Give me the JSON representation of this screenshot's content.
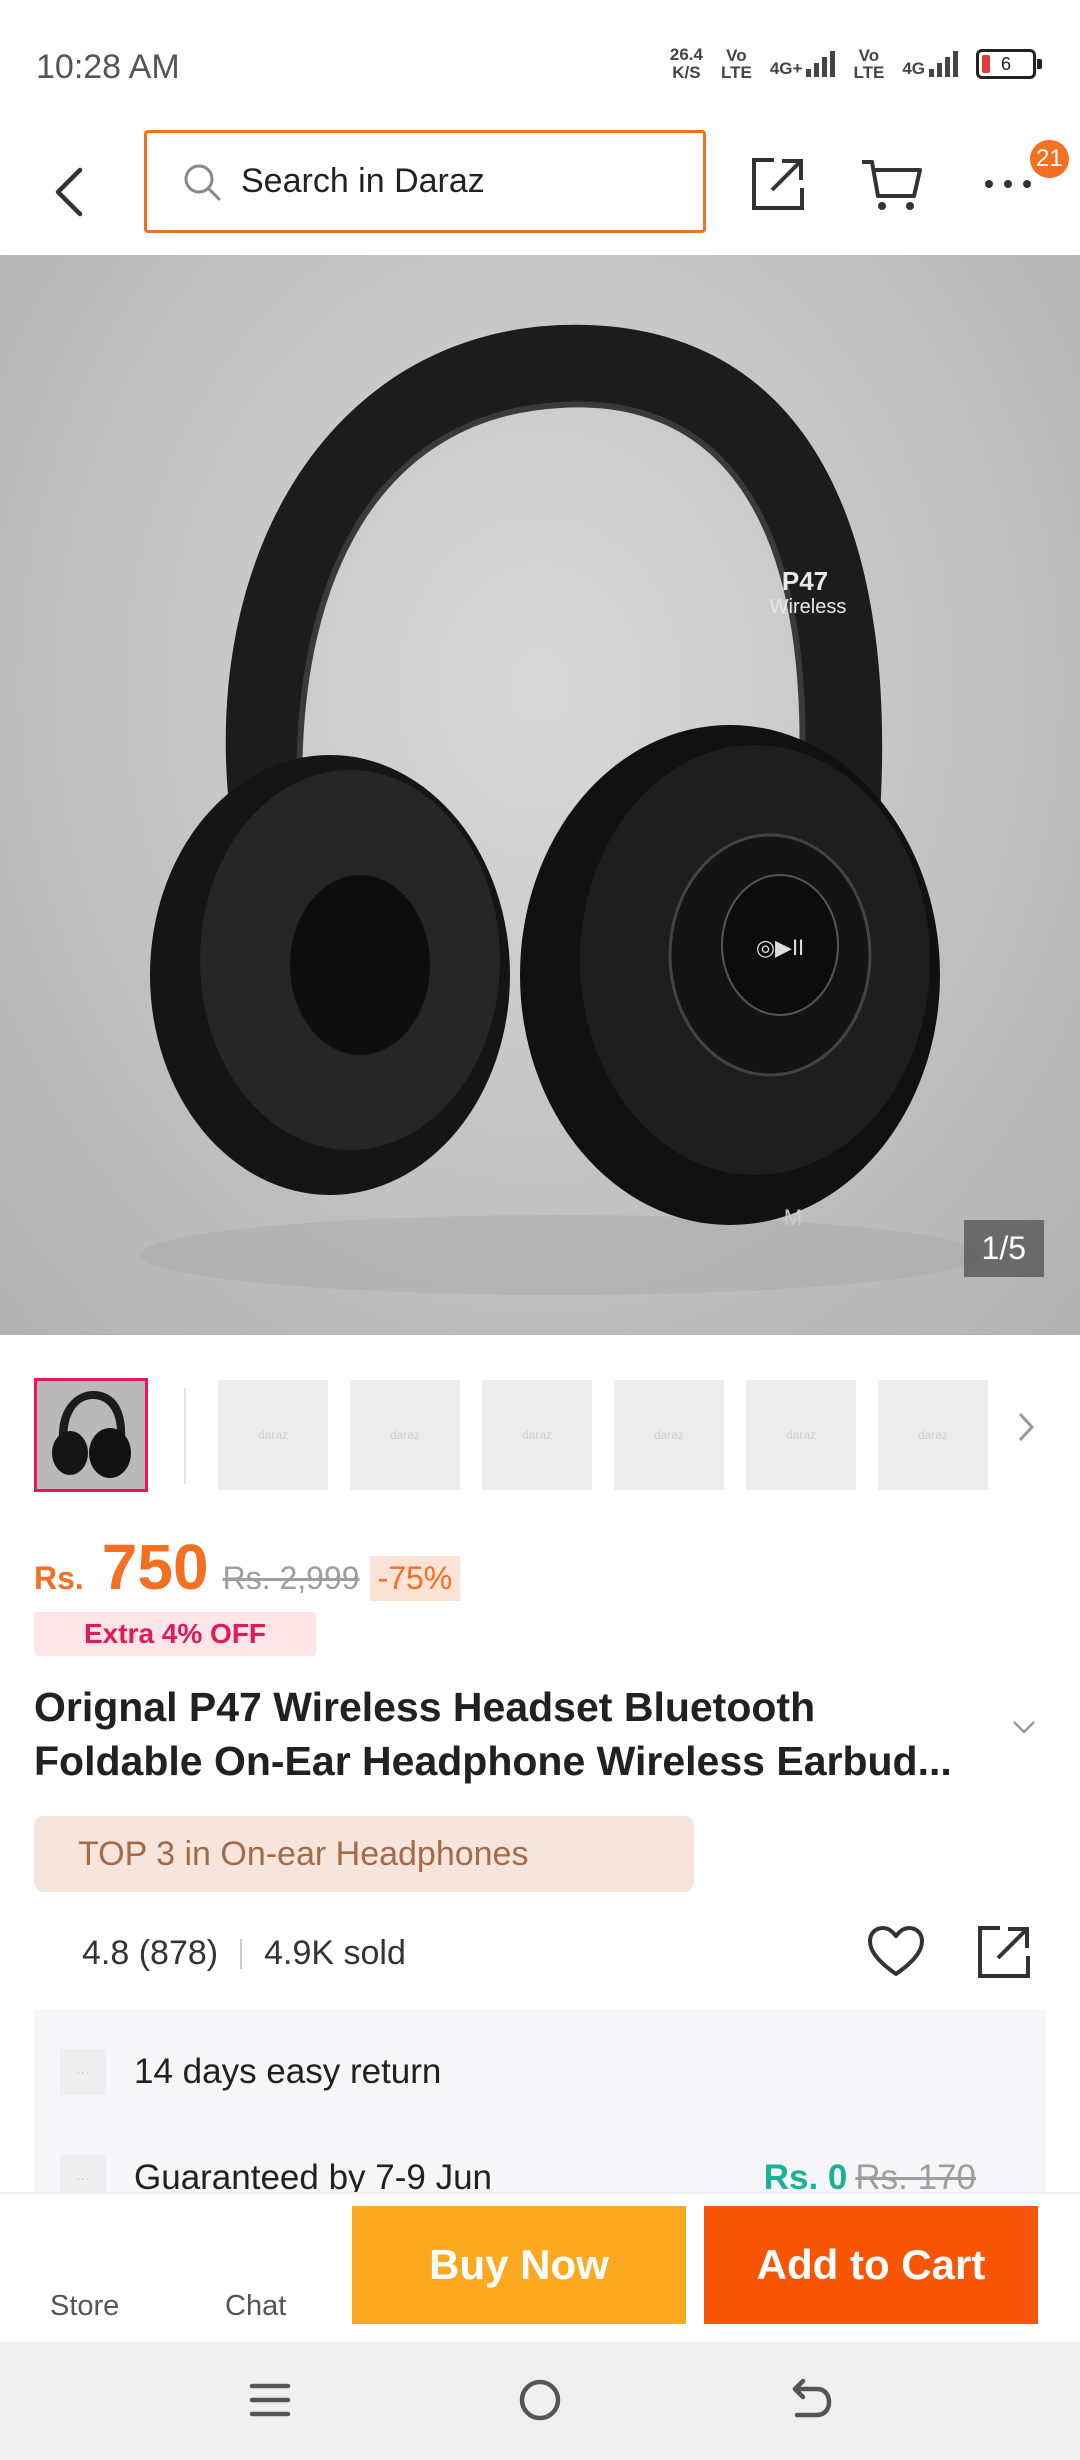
{
  "status_bar": {
    "time": "10:28 AM",
    "net_speed_value": "26.4",
    "net_speed_unit": "K/S",
    "sim1_label_top": "Vo",
    "sim1_label_bottom": "LTE",
    "sim1_net": "4G+",
    "sim2_label_top": "Vo",
    "sim2_label_bottom": "LTE",
    "sim2_net": "4G",
    "battery_level": "6"
  },
  "header": {
    "search_placeholder": "Search in Daraz",
    "more_badge": "21",
    "icons": [
      "back-arrow-icon",
      "search-icon",
      "share-icon",
      "cart-icon",
      "more-icon"
    ]
  },
  "gallery": {
    "counter": "1/5",
    "product_text_line1": "P47",
    "product_text_line2": "Wireless",
    "button_label": "M",
    "thumbnail_placeholder": "daraz"
  },
  "product": {
    "currency": "Rs.",
    "price": "750",
    "old_price": "Rs. 2,999",
    "discount": "-75%",
    "extra_offer": "Extra 4% OFF",
    "title": "Orignal P47 Wireless Headset Bluetooth Foldable On-Ear Headphone Wireless Earbud...",
    "top_tag": "TOP 3 in On-ear Headphones",
    "rating": "4.8 (878)",
    "sold": "4.9K sold"
  },
  "services": {
    "return_text": "14 days easy return",
    "delivery_text": "Guaranteed by 7-9 Jun",
    "delivery_fee": "Rs. 0",
    "delivery_fee_old": "Rs. 170",
    "icon_placeholder": "···"
  },
  "bottom_bar": {
    "store_label": "Store",
    "chat_label": "Chat",
    "buy_now_label": "Buy Now",
    "add_to_cart_label": "Add to Cart"
  },
  "colors": {
    "accent": "#f36f21",
    "buy_now": "#fca920",
    "add_to_cart": "#f85606",
    "extra_off": "#e4185c",
    "free_fee": "#1bb29c"
  }
}
